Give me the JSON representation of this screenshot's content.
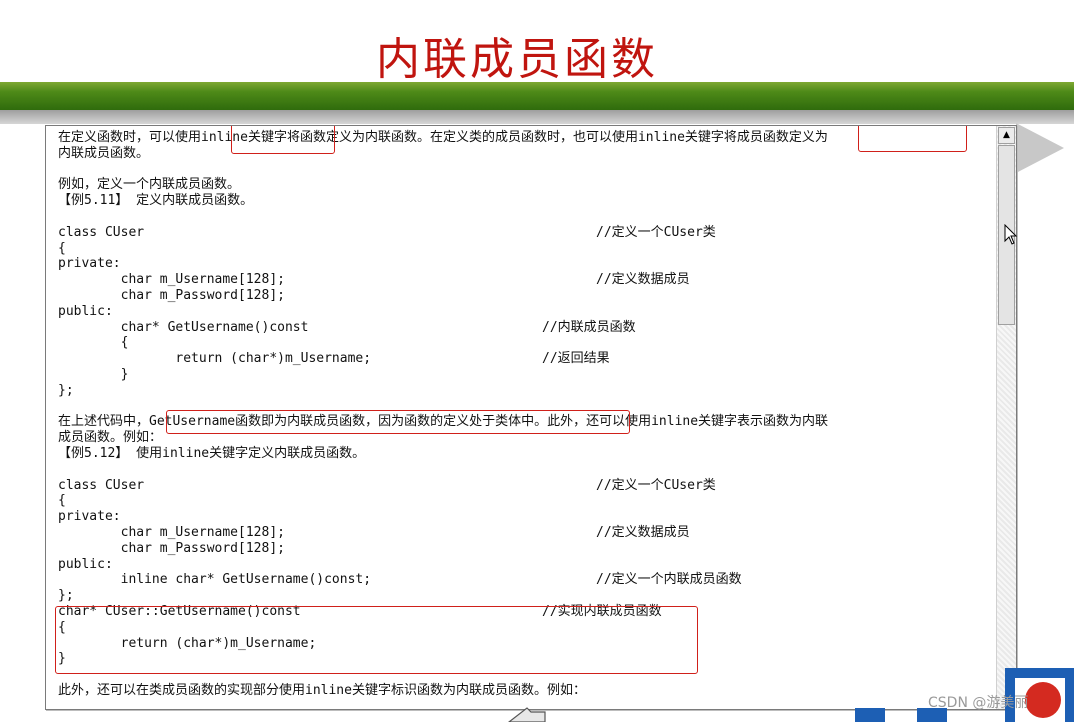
{
  "slide": {
    "title": "内联成员函数"
  },
  "document": {
    "lines": [
      {
        "text": "在定义函数时，可以使用inline关键字将函数定义为内联函数。在定义类的成员函数时，也可以使用inline关键字将成员函数定义为",
        "comment": ""
      },
      {
        "text": "内联成员函数。",
        "comment": ""
      },
      {
        "text": "",
        "comment": ""
      },
      {
        "text": "例如，定义一个内联成员函数。",
        "comment": ""
      },
      {
        "text": "【例5.11】 定义内联成员函数。",
        "comment": ""
      },
      {
        "text": "",
        "comment": ""
      },
      {
        "text": "class CUser",
        "comment": "//定义一个CUser类",
        "col": "c1"
      },
      {
        "text": "{",
        "comment": ""
      },
      {
        "text": "private:",
        "comment": ""
      },
      {
        "text": "        char m_Username[128];",
        "comment": "//定义数据成员",
        "col": "c1"
      },
      {
        "text": "        char m_Password[128];",
        "comment": ""
      },
      {
        "text": "public:",
        "comment": ""
      },
      {
        "text": "        char* GetUsername()const",
        "comment": "//内联成员函数",
        "col": "c2"
      },
      {
        "text": "        {",
        "comment": ""
      },
      {
        "text": "               return (char*)m_Username;",
        "comment": "//返回结果",
        "col": "c2"
      },
      {
        "text": "        }",
        "comment": ""
      },
      {
        "text": "};",
        "comment": ""
      },
      {
        "text": "",
        "comment": ""
      },
      {
        "text": "在上述代码中，GetUsername函数即为内联成员函数，因为函数的定义处于类体中。此外，还可以使用inline关键字表示函数为内联",
        "comment": ""
      },
      {
        "text": "成员函数。例如：",
        "comment": ""
      },
      {
        "text": "【例5.12】 使用inline关键字定义内联成员函数。",
        "comment": ""
      },
      {
        "text": "",
        "comment": ""
      },
      {
        "text": "class CUser",
        "comment": "//定义一个CUser类",
        "col": "c1"
      },
      {
        "text": "{",
        "comment": ""
      },
      {
        "text": "private:",
        "comment": ""
      },
      {
        "text": "        char m_Username[128];",
        "comment": "//定义数据成员",
        "col": "c1"
      },
      {
        "text": "        char m_Password[128];",
        "comment": ""
      },
      {
        "text": "public:",
        "comment": ""
      },
      {
        "text": "        inline char* GetUsername()const;",
        "comment": "//定义一个内联成员函数",
        "col": "c1"
      },
      {
        "text": "};",
        "comment": ""
      },
      {
        "text": "char* CUser::GetUsername()const",
        "comment": "//实现内联成员函数",
        "col": "c2"
      },
      {
        "text": "{",
        "comment": ""
      },
      {
        "text": "        return (char*)m_Username;",
        "comment": ""
      },
      {
        "text": "}",
        "comment": ""
      },
      {
        "text": "",
        "comment": ""
      },
      {
        "text": "此外，还可以在类成员函数的实现部分使用inline关键字标识函数为内联成员函数。例如：",
        "comment": ""
      }
    ]
  },
  "scrollbar": {
    "up_icon": "scroll-up-arrow-icon"
  },
  "watermark": {
    "text": "CSDN @游美丽"
  },
  "colors": {
    "title": "#c0150f",
    "highlight": "#d0201a",
    "bar": "#4e8a18"
  }
}
